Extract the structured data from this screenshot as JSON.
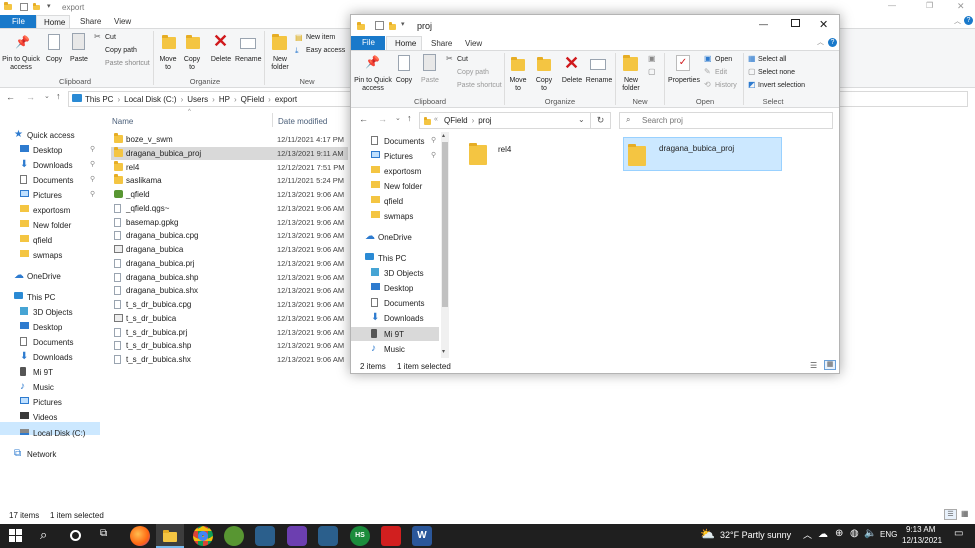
{
  "back": {
    "title": "export",
    "tabs": {
      "file": "File",
      "home": "Home",
      "share": "Share",
      "view": "View"
    },
    "ribbon": {
      "pin": "Pin to Quick access",
      "copy": "Copy",
      "paste": "Paste",
      "cut": "Cut",
      "copy_path": "Copy path",
      "paste_shortcut": "Paste shortcut",
      "clipboard": "Clipboard",
      "move_to": "Move to",
      "copy_to": "Copy to",
      "delete": "Delete",
      "rename": "Rename",
      "organize": "Organize",
      "new_folder": "New folder",
      "new_item": "New item",
      "easy_access": "Easy access",
      "new": "New"
    },
    "path": [
      "This PC",
      "Local Disk (C:)",
      "Users",
      "HP",
      "QField",
      "export"
    ],
    "col_name": "Name",
    "col_date": "Date modified",
    "nav": [
      {
        "label": "Quick access",
        "icon": "star-icon"
      },
      {
        "label": "Desktop",
        "icon": "desktop-icon"
      },
      {
        "label": "Downloads",
        "icon": "download-icon"
      },
      {
        "label": "Documents",
        "icon": "document-icon"
      },
      {
        "label": "Pictures",
        "icon": "picture-icon"
      },
      {
        "label": "exportosm",
        "icon": "folder-icon"
      },
      {
        "label": "New folder",
        "icon": "folder-icon"
      },
      {
        "label": "qfield",
        "icon": "folder-icon"
      },
      {
        "label": "swmaps",
        "icon": "folder-icon"
      },
      {
        "label": "OneDrive",
        "icon": "cloud-icon"
      },
      {
        "label": "This PC",
        "icon": "computer-icon"
      },
      {
        "label": "3D Objects",
        "icon": "cube-icon"
      },
      {
        "label": "Desktop",
        "icon": "desktop-icon"
      },
      {
        "label": "Documents",
        "icon": "document-icon"
      },
      {
        "label": "Downloads",
        "icon": "download-icon"
      },
      {
        "label": "Mi 9T",
        "icon": "phone-icon"
      },
      {
        "label": "Music",
        "icon": "music-icon"
      },
      {
        "label": "Pictures",
        "icon": "picture-icon"
      },
      {
        "label": "Videos",
        "icon": "video-icon"
      },
      {
        "label": "Local Disk (C:)",
        "icon": "drive-icon"
      },
      {
        "label": "Network",
        "icon": "network-icon"
      }
    ],
    "files": [
      {
        "name": "boze_v_swm",
        "date": "12/11/2021 4:17 PM",
        "icon": "folder"
      },
      {
        "name": "dragana_bubica_proj",
        "date": "12/13/2021 9:11 AM",
        "icon": "folder"
      },
      {
        "name": "rel4",
        "date": "12/12/2021 7:51 PM",
        "icon": "folder"
      },
      {
        "name": "saslikama",
        "date": "12/11/2021 5:24 PM",
        "icon": "folder"
      },
      {
        "name": "_qfield",
        "date": "12/13/2021 9:06 AM",
        "icon": "qgis"
      },
      {
        "name": "_qfield.qgs~",
        "date": "12/13/2021 9:06 AM",
        "icon": "doc"
      },
      {
        "name": "basemap.gpkg",
        "date": "12/13/2021 9:06 AM",
        "icon": "doc"
      },
      {
        "name": "dragana_bubica.cpg",
        "date": "12/13/2021 9:06 AM",
        "icon": "doc"
      },
      {
        "name": "dragana_bubica",
        "date": "12/13/2021 9:06 AM",
        "icon": "db"
      },
      {
        "name": "dragana_bubica.prj",
        "date": "12/13/2021 9:06 AM",
        "icon": "doc"
      },
      {
        "name": "dragana_bubica.shp",
        "date": "12/13/2021 9:06 AM",
        "icon": "doc"
      },
      {
        "name": "dragana_bubica.shx",
        "date": "12/13/2021 9:06 AM",
        "icon": "doc"
      },
      {
        "name": "t_s_dr_bubica.cpg",
        "date": "12/13/2021 9:06 AM",
        "icon": "doc"
      },
      {
        "name": "t_s_dr_bubica",
        "date": "12/13/2021 9:06 AM",
        "icon": "db"
      },
      {
        "name": "t_s_dr_bubica.prj",
        "date": "12/13/2021 9:06 AM",
        "icon": "doc"
      },
      {
        "name": "t_s_dr_bubica.shp",
        "date": "12/13/2021 9:06 AM",
        "icon": "doc"
      },
      {
        "name": "t_s_dr_bubica.shx",
        "date": "12/13/2021 9:06 AM",
        "icon": "doc"
      }
    ],
    "status_count": "17 items",
    "status_selected": "1 item selected"
  },
  "front": {
    "title": "proj",
    "tabs": {
      "file": "File",
      "home": "Home",
      "share": "Share",
      "view": "View"
    },
    "ribbon": {
      "pin": "Pin to Quick access",
      "copy": "Copy",
      "paste": "Paste",
      "cut": "Cut",
      "copy_path": "Copy path",
      "paste_shortcut": "Paste shortcut",
      "clipboard": "Clipboard",
      "move_to": "Move to",
      "copy_to": "Copy to",
      "delete": "Delete",
      "rename": "Rename",
      "organize": "Organize",
      "new_folder": "New folder",
      "new": "New",
      "properties": "Properties",
      "open": "Open",
      "edit": "Edit",
      "history": "History",
      "open_group": "Open",
      "select_all": "Select all",
      "select_none": "Select none",
      "invert_selection": "Invert selection",
      "select_group": "Select"
    },
    "path": [
      "QField",
      "proj"
    ],
    "search_placeholder": "Search proj",
    "nav": [
      {
        "label": "Documents",
        "icon": "document-icon"
      },
      {
        "label": "Pictures",
        "icon": "picture-icon"
      },
      {
        "label": "exportosm",
        "icon": "folder-icon"
      },
      {
        "label": "New folder",
        "icon": "folder-icon"
      },
      {
        "label": "qfield",
        "icon": "folder-icon"
      },
      {
        "label": "swmaps",
        "icon": "folder-icon"
      },
      {
        "label": "OneDrive",
        "icon": "cloud-icon"
      },
      {
        "label": "This PC",
        "icon": "computer-icon"
      },
      {
        "label": "3D Objects",
        "icon": "cube-icon"
      },
      {
        "label": "Desktop",
        "icon": "desktop-icon"
      },
      {
        "label": "Documents",
        "icon": "document-icon"
      },
      {
        "label": "Downloads",
        "icon": "download-icon"
      },
      {
        "label": "Mi 9T",
        "icon": "phone-icon"
      },
      {
        "label": "Music",
        "icon": "music-icon"
      }
    ],
    "items": [
      {
        "name": "rel4"
      },
      {
        "name": "dragana_bubica_proj"
      }
    ],
    "status_count": "2 items",
    "status_selected": "1 item selected"
  },
  "taskbar": {
    "weather": "32°F  Partly sunny",
    "lang": "ENG",
    "time": "9:13 AM",
    "date": "12/13/2021",
    "apps": [
      "search-icon",
      "cortana-icon",
      "task-view-icon",
      "firefox-icon",
      "file-explorer-icon",
      "chrome-icon",
      "qgis-icon",
      "app-icon",
      "app-icon-2",
      "app-icon-3",
      "hs-icon",
      "acrobat-icon",
      "word-icon"
    ],
    "hs_label": "HS"
  },
  "colors": {
    "accent": "#0078d7",
    "selection": "#cce8ff",
    "taskbar": "#1f1f1f",
    "folder": "#f4c542"
  }
}
